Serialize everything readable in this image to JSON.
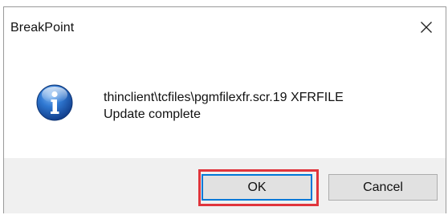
{
  "window": {
    "title": "BreakPoint",
    "close_icon": "close-icon"
  },
  "message": {
    "icon": "info-icon",
    "line1": "thinclient\\tcfiles\\pgmfilexfr.scr.19 XFRFILE",
    "line2": "Update complete"
  },
  "buttons": {
    "ok_label": "OK",
    "cancel_label": "Cancel"
  },
  "colors": {
    "highlight": "#e0353c",
    "focus": "#0078d7",
    "footer_bg": "#f0f0f0",
    "info_blue": "#1d5fb8"
  }
}
